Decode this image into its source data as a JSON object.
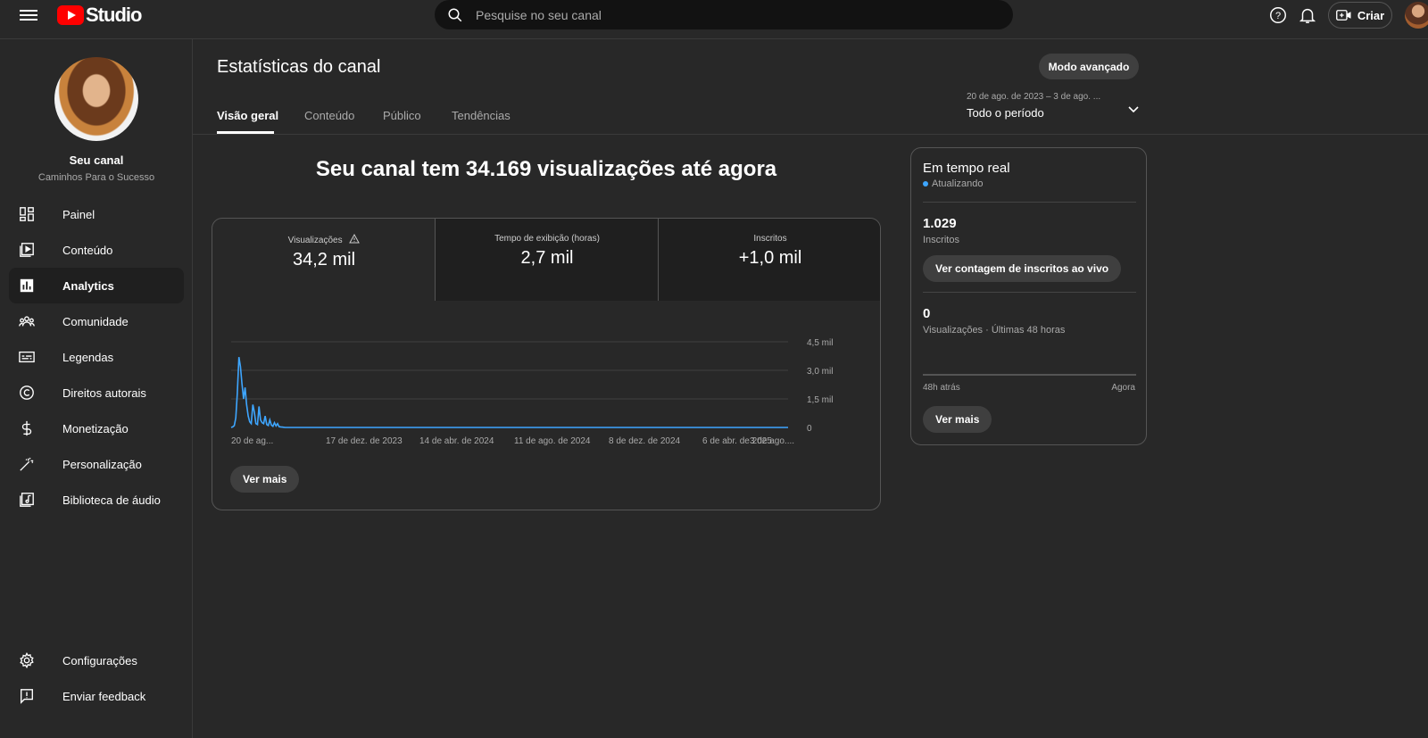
{
  "topbar": {
    "logo_text": "Studio",
    "search_placeholder": "Pesquise no seu canal",
    "create_label": "Criar"
  },
  "sidebar": {
    "channel_name": "Seu canal",
    "channel_subtitle": "Caminhos Para o Sucesso",
    "items": [
      {
        "label": "Painel",
        "icon": "dashboard-icon"
      },
      {
        "label": "Conteúdo",
        "icon": "content-icon"
      },
      {
        "label": "Analytics",
        "icon": "analytics-icon",
        "active": true
      },
      {
        "label": "Comunidade",
        "icon": "community-icon"
      },
      {
        "label": "Legendas",
        "icon": "subtitles-icon"
      },
      {
        "label": "Direitos autorais",
        "icon": "copyright-icon"
      },
      {
        "label": "Monetização",
        "icon": "monetization-icon"
      },
      {
        "label": "Personalização",
        "icon": "customization-icon"
      },
      {
        "label": "Biblioteca de áudio",
        "icon": "audio-library-icon"
      }
    ],
    "footer": [
      {
        "label": "Configurações",
        "icon": "settings-icon"
      },
      {
        "label": "Enviar feedback",
        "icon": "feedback-icon"
      }
    ]
  },
  "main": {
    "title": "Estatísticas do canal",
    "advanced_mode": "Modo avançado",
    "tabs": [
      "Visão geral",
      "Conteúdo",
      "Público",
      "Tendências"
    ],
    "period_range": "20 de ago. de 2023 – 3 de ago. ...",
    "period_value": "Todo o período",
    "headline": "Seu canal tem 34.169 visualizações até agora",
    "metrics": [
      {
        "label": "Visualizações",
        "value": "34,2 mil",
        "warning": true
      },
      {
        "label": "Tempo de exibição (horas)",
        "value": "2,7 mil"
      },
      {
        "label": "Inscritos",
        "value": "+1,0 mil"
      }
    ],
    "see_more": "Ver mais"
  },
  "chart_data": {
    "type": "line",
    "series_color": "#3ea6ff",
    "x_tick_labels": [
      "20 de ag...",
      "17 de dez. de 2023",
      "14 de abr. de 2024",
      "11 de ago. de 2024",
      "8 de dez. de 2024",
      "6 de abr. de 2025",
      "3 de ago...."
    ],
    "y_tick_labels": [
      "4,5 mil",
      "3,0 mil",
      "1,5 mil",
      "0"
    ],
    "ylim": [
      0,
      4500
    ],
    "grid": true,
    "series": [
      {
        "x_index_of_720_days": [
          0,
          2,
          4,
          6,
          8,
          10,
          12,
          14,
          16,
          18,
          20,
          22,
          24,
          26,
          28,
          30,
          32,
          34,
          36,
          38,
          40,
          42,
          44,
          46,
          48,
          50,
          52,
          54,
          56,
          58,
          60,
          62,
          64,
          66,
          68,
          70,
          720
        ],
        "values": [
          0,
          30,
          100,
          500,
          1800,
          3700,
          3200,
          2300,
          1500,
          2100,
          1200,
          600,
          300,
          200,
          1200,
          800,
          200,
          150,
          1100,
          400,
          250,
          200,
          600,
          150,
          100,
          400,
          120,
          60,
          250,
          80,
          200,
          40,
          30,
          20,
          10,
          0,
          0
        ]
      }
    ]
  },
  "realtime": {
    "title": "Em tempo real",
    "status": "Atualizando",
    "subscribers_value": "1.029",
    "subscribers_label": "Inscritos",
    "live_count_button": "Ver contagem de inscritos ao vivo",
    "views_value": "0",
    "views_label": "Visualizações · Últimas 48 horas",
    "axis_left": "48h atrás",
    "axis_right": "Agora",
    "see_more": "Ver mais"
  }
}
